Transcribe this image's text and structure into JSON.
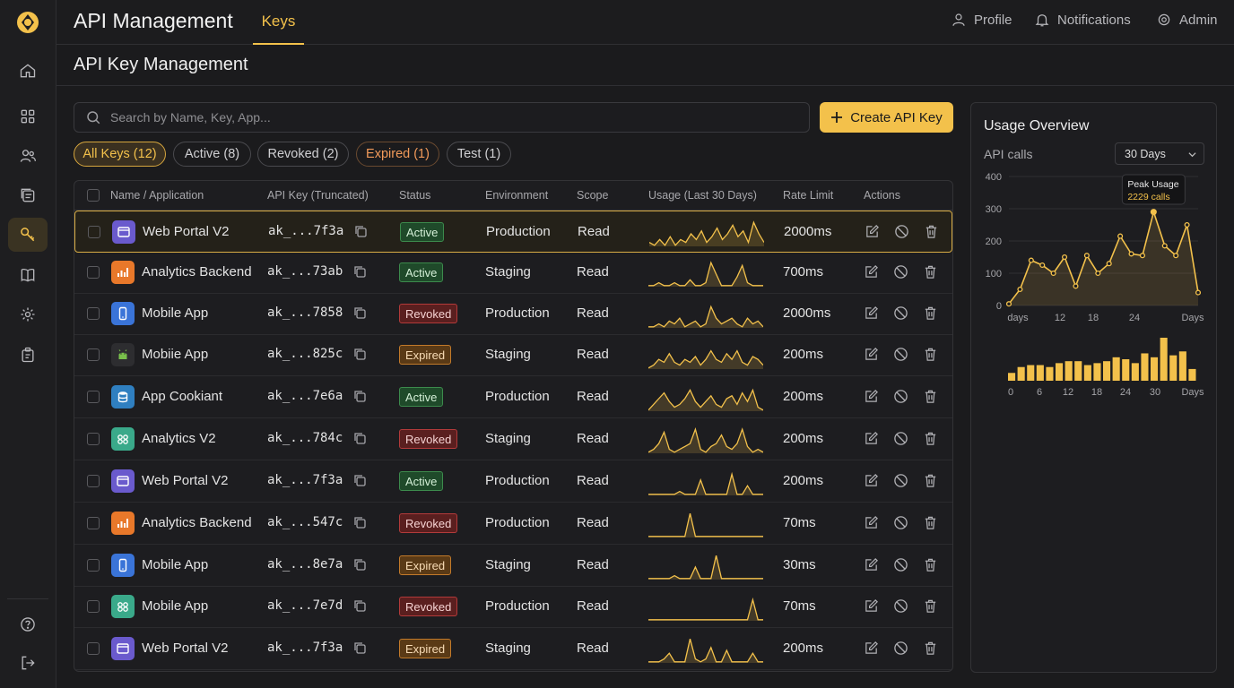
{
  "app": {
    "title": "API Management",
    "active_tab": "Keys"
  },
  "topbar": {
    "profile": "Profile",
    "notifications": "Notifications",
    "admin": "Admin"
  },
  "page": {
    "title": "API Key Management"
  },
  "search": {
    "placeholder": "Search by Name, Key, App..."
  },
  "create_button": "Create API Key",
  "filters": [
    "All Keys (12)",
    "Active (8)",
    "Revoked (2)",
    "Expired (1)",
    "Test (1)"
  ],
  "table": {
    "headers": [
      "Name / Application",
      "API Key (Truncated)",
      "Status",
      "Environment",
      "Scope",
      "Usage (Last 30 Days)",
      "Rate Limit",
      "Actions"
    ],
    "rows": [
      {
        "name": "Web Portal V2",
        "icon": "browser-window-icon",
        "key": "ak_...7f3a",
        "status": "Active",
        "env": "Production",
        "scope": "Read",
        "rate": "2000ms"
      },
      {
        "name": "Analytics Backend",
        "icon": "bar-chart-icon",
        "key": "ak_...73ab",
        "status": "Active",
        "env": "Staging",
        "scope": "Read",
        "rate": "700ms"
      },
      {
        "name": "Mobile App",
        "icon": "phone-icon",
        "key": "ak_...7858",
        "status": "Revoked",
        "env": "Production",
        "scope": "Read",
        "rate": "2000ms"
      },
      {
        "name": "Mobiie App",
        "icon": "android-icon",
        "key": "ak_...825c",
        "status": "Expired",
        "env": "Staging",
        "scope": "Read",
        "rate": "200ms"
      },
      {
        "name": "App Cookiant",
        "icon": "database-icon",
        "key": "ak_...7e6a",
        "status": "Active",
        "env": "Production",
        "scope": "Read",
        "rate": "200ms"
      },
      {
        "name": "Analytics V2",
        "icon": "link-nodes-icon",
        "key": "ak_...784c",
        "status": "Revoked",
        "env": "Staging",
        "scope": "Read",
        "rate": "200ms"
      },
      {
        "name": "Web Portal V2",
        "icon": "browser-window-icon",
        "key": "ak_...7f3a",
        "status": "Active",
        "env": "Production",
        "scope": "Read",
        "rate": "200ms"
      },
      {
        "name": "Analytics Backend",
        "icon": "bar-chart-icon",
        "key": "ak_...547c",
        "status": "Revoked",
        "env": "Production",
        "scope": "Read",
        "rate": "70ms"
      },
      {
        "name": "Mobile App",
        "icon": "phone-icon",
        "key": "ak_...8e7a",
        "status": "Expired",
        "env": "Staging",
        "scope": "Read",
        "rate": "30ms"
      },
      {
        "name": "Mobile App",
        "icon": "link-nodes-icon",
        "key": "ak_...7e7d",
        "status": "Revoked",
        "env": "Production",
        "scope": "Read",
        "rate": "70ms"
      },
      {
        "name": "Web Portal V2",
        "icon": "browser-window-icon",
        "key": "ak_...7f3a",
        "status": "Expired",
        "env": "Staging",
        "scope": "Read",
        "rate": "200ms"
      }
    ]
  },
  "usage_overview": {
    "title": "Usage Overview",
    "label": "API calls",
    "range": "30 Days",
    "tooltip_title": "Peak Usage",
    "tooltip_value": "2229 calls"
  },
  "colors": {
    "accent": "#f3c14b",
    "background": "#1b1b1d",
    "active": "#3c8a4c",
    "revoked": "#b23a3a",
    "expired": "#c27a2a"
  },
  "chart_data": [
    {
      "type": "line",
      "ylim": [
        0,
        400
      ],
      "yticks": [
        "0",
        "100",
        "200",
        "300",
        "400"
      ],
      "xticks": [
        "days",
        "12",
        "18",
        "24",
        "Days"
      ],
      "x": [
        1,
        3,
        5,
        7,
        9,
        11,
        13,
        15,
        17,
        19,
        21,
        23,
        25,
        27,
        29,
        31,
        33,
        35
      ],
      "values": [
        5,
        50,
        140,
        125,
        100,
        150,
        60,
        155,
        100,
        130,
        215,
        160,
        155,
        290,
        185,
        155,
        250,
        40
      ]
    },
    {
      "type": "bar",
      "xticks": [
        "0",
        "6",
        "12",
        "18",
        "24",
        "30",
        "Days"
      ],
      "values": [
        4,
        7,
        8,
        8,
        7,
        9,
        10,
        10,
        8,
        9,
        10,
        12,
        11,
        9,
        14,
        12,
        22,
        13,
        15,
        6
      ]
    }
  ]
}
